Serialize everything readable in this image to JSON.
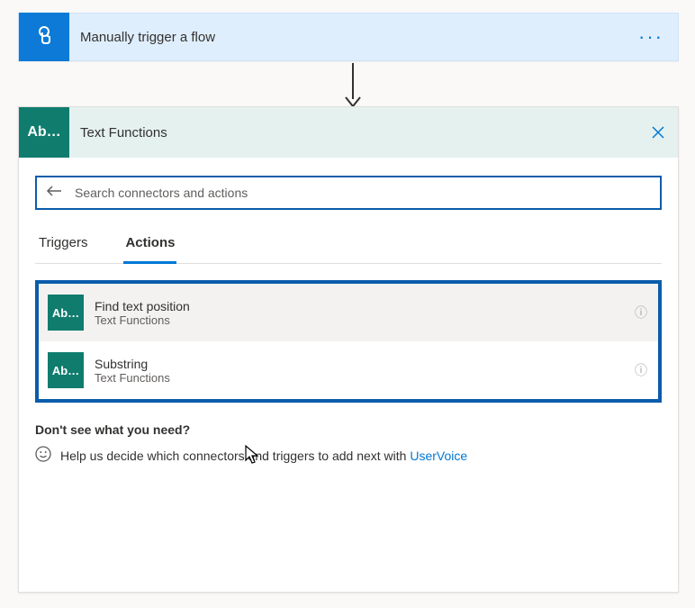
{
  "trigger": {
    "title": "Manually trigger a flow",
    "icon": "tap-icon"
  },
  "picker": {
    "connector_icon_text": "Ab…",
    "connector_title": "Text Functions",
    "search": {
      "placeholder": "Search connectors and actions",
      "value": ""
    },
    "tabs": [
      {
        "label": "Triggers",
        "active": false
      },
      {
        "label": "Actions",
        "active": true
      }
    ],
    "item_icon_text": "Ab…",
    "items": [
      {
        "title": "Find text position",
        "subtitle": "Text Functions"
      },
      {
        "title": "Substring",
        "subtitle": "Text Functions"
      }
    ],
    "footer": {
      "question": "Don't see what you need?",
      "help_text_prefix": "Help us decide which connectors and triggers to add next with ",
      "link_text": "UserVoice"
    }
  }
}
